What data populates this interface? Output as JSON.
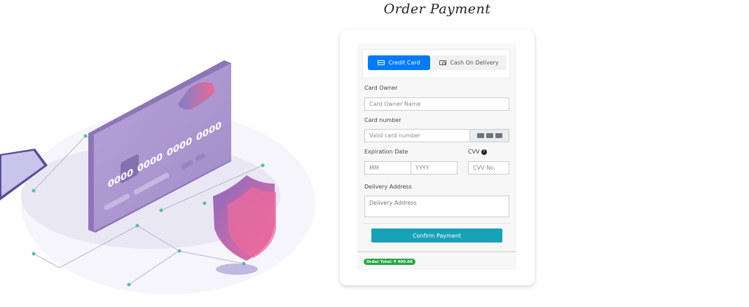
{
  "page_title": "Order Payment",
  "tabs": [
    {
      "label": "Credit Card",
      "icon": "credit-card-icon",
      "active": true
    },
    {
      "label": "Cash On Delivery",
      "icon": "cash-icon",
      "active": false
    }
  ],
  "form": {
    "card_owner_label": "Card Owner",
    "card_owner_placeholder": "Card Owner Name",
    "card_number_label": "Card number",
    "card_number_placeholder": "Valid card number",
    "expiration_label": "Expiration Date",
    "mm_placeholder": "MM",
    "yyyy_placeholder": "YYYY",
    "cvv_label": "CVV",
    "cvv_placeholder": "CVV No.",
    "address_label": "Delivery Address",
    "address_placeholder": "Delivery Address",
    "confirm_label": "Confirm Payment"
  },
  "order_total": "Order Total: ₹ 400.00",
  "card_art": {
    "nums": [
      "0000",
      "0000",
      "0000",
      "0000"
    ]
  },
  "colors": {
    "primary": "#007bff",
    "confirm": "#17a2b8",
    "badge": "#28a745"
  }
}
